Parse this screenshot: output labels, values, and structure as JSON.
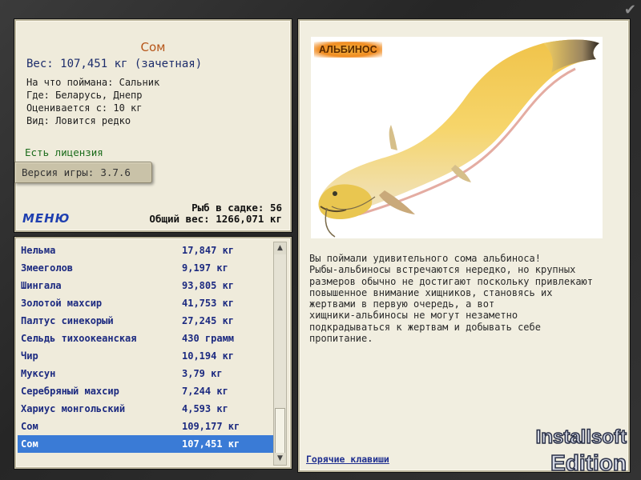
{
  "fish": {
    "title": "Сом",
    "weight": "Вес: 107,451 кг (зачетная)",
    "caught_on": "На что поймана: Сальник",
    "where": "Где: Беларусь, Днепр",
    "valued_from": "Оценивается с: 10 кг",
    "kind": "Вид: Ловится редко",
    "license": "Есть лицензия"
  },
  "version": {
    "label": "Версия игры:",
    "value": "3.7.6"
  },
  "stats": {
    "fish_in_keepnet": "Рыб в садке: 56",
    "total_weight": "Общий вес: 1266,071 кг"
  },
  "menu_label": "МЕНЮ",
  "catch_list": [
    {
      "name": "Нельма",
      "weight": "17,847 кг"
    },
    {
      "name": "Змееголов",
      "weight": "9,197 кг"
    },
    {
      "name": "Шингала",
      "weight": "93,805 кг"
    },
    {
      "name": "Золотой махсир",
      "weight": "41,753 кг"
    },
    {
      "name": "Палтус синекорый",
      "weight": "27,245 кг"
    },
    {
      "name": "Сельдь тихоокеанская",
      "weight": "430 грамм"
    },
    {
      "name": "Чир",
      "weight": "10,194 кг"
    },
    {
      "name": "Муксун",
      "weight": "3,79 кг"
    },
    {
      "name": "Серебряный махсир",
      "weight": "7,244 кг"
    },
    {
      "name": "Хариус монгольский",
      "weight": "4,593 кг"
    },
    {
      "name": "Сом",
      "weight": "109,177 кг"
    },
    {
      "name": "Сом",
      "weight": "107,451 кг",
      "selected": true
    }
  ],
  "image_badge": "АЛЬБИНОС",
  "description": [
    "Вы поймали удивительного сома альбиноса!",
    "Рыбы-альбиносы встречаются нередко, но крупных",
    "размеров обычно не достигают поскольку привлекают",
    "повышенное внимание хищников, становясь их",
    "жертвами в первую очередь, а вот",
    "хищники-альбиносы не могут незаметно",
    "подкрадываться к жертвам и добывать себе",
    "пропитание."
  ],
  "hotkeys_label": "Горячие клавиши",
  "watermark": [
    "Installsoft",
    "Edition"
  ],
  "colors": {
    "panel_bg": "#efebdb",
    "selection": "#3a7bd6",
    "title": "#b6561a",
    "link": "#1f3fb0"
  }
}
